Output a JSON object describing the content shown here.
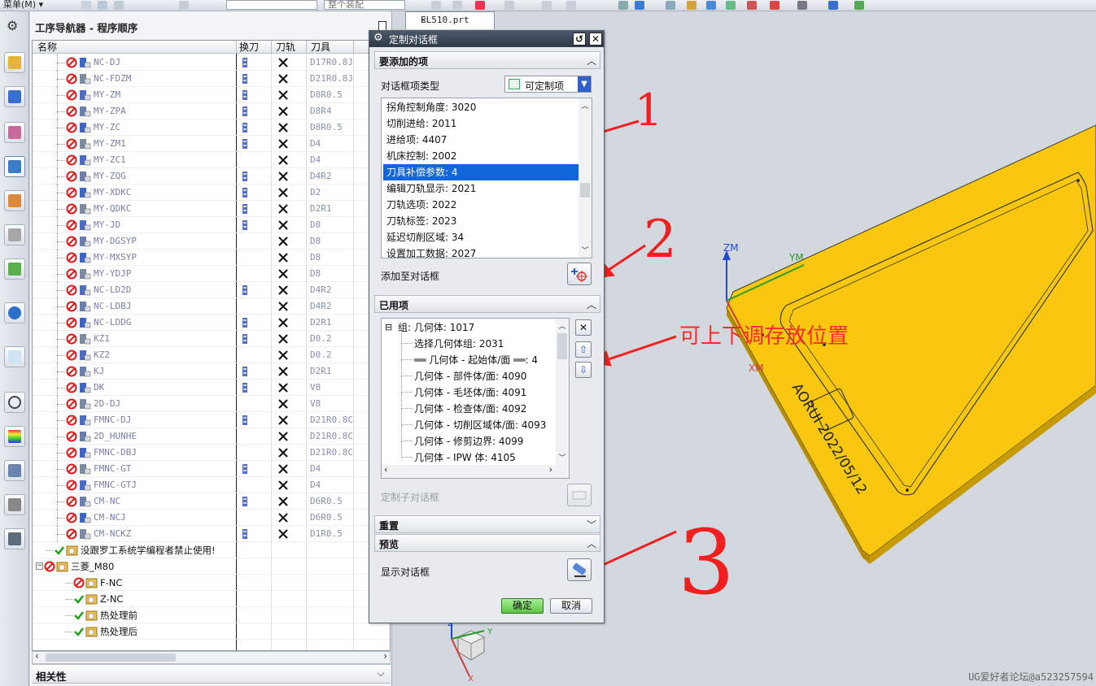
{
  "toolbar": {
    "menu": "菜单(M) ▾",
    "combo1": "",
    "combo2": "整个装配"
  },
  "navigator": {
    "title": "工序导航器 - 程序顺序",
    "columns": {
      "name": "名称",
      "tool_change": "换刀",
      "tool_path": "刀轨",
      "tool": "刀具"
    },
    "operations": [
      {
        "name": "NC-DJ",
        "tool": "D17R0.8J",
        "tc": true
      },
      {
        "name": "NC-FDZM",
        "tool": "D21R0.8J",
        "tc": true
      },
      {
        "name": "MY-ZM",
        "tool": "D8R0.5",
        "tc": true
      },
      {
        "name": "MY-ZPA",
        "tool": "D8R4",
        "tc": true
      },
      {
        "name": "MY-ZC",
        "tool": "D8R0.5",
        "tc": true
      },
      {
        "name": "MY-ZM1",
        "tool": "D4",
        "tc": true
      },
      {
        "name": "MY-ZC1",
        "tool": "D4",
        "tc": false
      },
      {
        "name": "MY-ZQG",
        "tool": "D4R2",
        "tc": true
      },
      {
        "name": "MY-XDKC",
        "tool": "D2",
        "tc": true
      },
      {
        "name": "MY-QDKC",
        "tool": "D2R1",
        "tc": true
      },
      {
        "name": "MY-JD",
        "tool": "D8",
        "tc": true
      },
      {
        "name": "MY-DGSYP",
        "tool": "D8",
        "tc": false
      },
      {
        "name": "MY-MXSYP",
        "tool": "D8",
        "tc": false
      },
      {
        "name": "MY-YDJP",
        "tool": "D8",
        "tc": false
      },
      {
        "name": "NC-LD2D",
        "tool": "D4R2",
        "tc": true
      },
      {
        "name": "NC-LDBJ",
        "tool": "D4R2",
        "tc": false
      },
      {
        "name": "NC-LDDG",
        "tool": "D2R1",
        "tc": true
      },
      {
        "name": "KZ1",
        "tool": "D0.2",
        "tc": true
      },
      {
        "name": "KZ2",
        "tool": "D0.2",
        "tc": false
      },
      {
        "name": "KJ",
        "tool": "D2R1",
        "tc": true
      },
      {
        "name": "DK",
        "tool": "V8",
        "tc": true
      },
      {
        "name": "2D-DJ",
        "tool": "V8",
        "tc": false
      },
      {
        "name": "FMNC-DJ",
        "tool": "D21R0.8C",
        "tc": true
      },
      {
        "name": "2D_HUNHE",
        "tool": "D21R0.8C",
        "tc": false
      },
      {
        "name": "FMNC-DBJ",
        "tool": "D21R0.8C",
        "tc": false
      },
      {
        "name": "FMNC-GT",
        "tool": "D4",
        "tc": true
      },
      {
        "name": "FMNC-GTJ",
        "tool": "D4",
        "tc": false
      },
      {
        "name": "CM-NC",
        "tool": "D6R0.5",
        "tc": true
      },
      {
        "name": "CM-NCJ",
        "tool": "D6R0.5",
        "tc": false
      },
      {
        "name": "CM-NCKZ",
        "tool": "D1R0.5",
        "tc": true
      }
    ],
    "groups": [
      {
        "name": "没跟罗工系统学编程者禁止使用!",
        "status": "ok"
      },
      {
        "name": "三菱_M80",
        "status": "blocked"
      },
      {
        "name": "F-NC",
        "status": "blocked"
      },
      {
        "name": "Z-NC",
        "status": "ok"
      },
      {
        "name": "热处理前",
        "status": "ok"
      },
      {
        "name": "热处理后",
        "status": "ok"
      }
    ],
    "related_title": "相关性"
  },
  "viewport": {
    "tab_name": "EL510.prt",
    "axis_labels": {
      "zm": "ZM",
      "ym": "YM",
      "xm": "XM",
      "x": "X",
      "y": "Y",
      "z": "Z"
    },
    "engraving": "AORUI 2022/05/12",
    "annotation_text": "可上下调存放位置",
    "annotation_numbers": [
      "1",
      "2",
      "3"
    ],
    "watermark": "UG爱好者论坛@a523257594"
  },
  "dialog": {
    "title": "定制对话框",
    "sec_add": "要添加的项",
    "type_label": "对话框项类型",
    "type_value": "可定制项",
    "items": [
      "拐角控制角度: 3020",
      "切削进给: 2011",
      "进给项: 4407",
      "机床控制: 2002",
      "刀具补偿参数: 4",
      "编辑刀轨显示: 2021",
      "刀轨选项: 2022",
      "刀轨标签: 2023",
      "延迟切削区域: 34",
      "设置加工数据: 2027"
    ],
    "selected_index": 4,
    "add_label": "添加至对话框",
    "sec_used": "已用项",
    "used_items": [
      "组: 几何体: 1017",
      "选择几何体组: 2031",
      "══ 几何体 - 起始体/面 ══: 4",
      "几何体 - 部件体/面: 4090",
      "几何体 - 毛坯体/面: 4091",
      "几何体 - 检查体/面: 4092",
      "几何体 - 切削区域体/面: 4093",
      "几何体 - 修剪边界: 4099",
      "几何体 - IPW 体: 4105"
    ],
    "sub_label": "定制子对话框",
    "sec_reset": "重置",
    "sec_preview": "预览",
    "show_label": "显示对话框",
    "ok": "确定",
    "cancel": "取消"
  }
}
